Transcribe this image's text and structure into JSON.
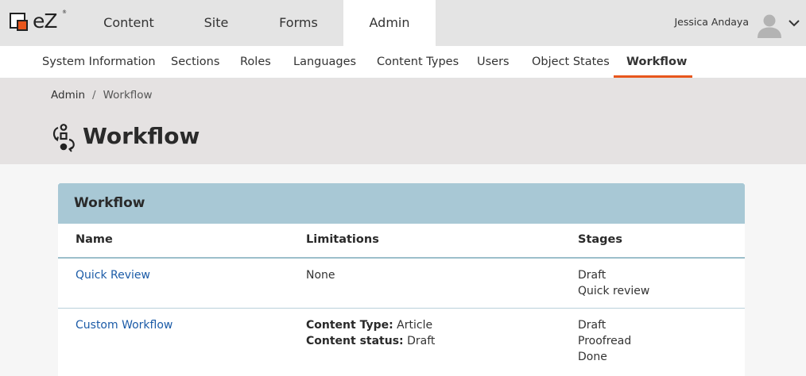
{
  "app": {
    "logo_text": "eZ",
    "logo_tm": "®"
  },
  "main_nav": [
    {
      "label": "Content"
    },
    {
      "label": "Site"
    },
    {
      "label": "Forms"
    },
    {
      "label": "Admin",
      "active": true
    }
  ],
  "user": {
    "name": "Jessica Andaya"
  },
  "sub_nav": [
    {
      "label": "System Information"
    },
    {
      "label": "Sections"
    },
    {
      "label": "Roles"
    },
    {
      "label": "Languages"
    },
    {
      "label": "Content Types"
    },
    {
      "label": "Users"
    },
    {
      "label": "Object States"
    },
    {
      "label": "Workflow",
      "active": true
    }
  ],
  "breadcrumb": {
    "root": "Admin",
    "separator": "/",
    "current": "Workflow"
  },
  "page": {
    "title": "Workflow",
    "icon": "workflow-icon"
  },
  "card": {
    "title": "Workflow",
    "columns": {
      "name": "Name",
      "limitations": "Limitations",
      "stages": "Stages"
    },
    "rows": [
      {
        "name": "Quick Review",
        "limitations_text": "None",
        "stages": [
          "Draft",
          "Quick review"
        ]
      },
      {
        "name": "Custom Workflow",
        "limitations": [
          {
            "label": "Content Type:",
            "value": "Article"
          },
          {
            "label": "Content status:",
            "value": "Draft"
          }
        ],
        "stages": [
          "Draft",
          "Proofread",
          "Done"
        ]
      }
    ]
  },
  "colors": {
    "accent": "#e8561c",
    "card_header": "#a8c8d5",
    "link": "#1b5ba7"
  }
}
